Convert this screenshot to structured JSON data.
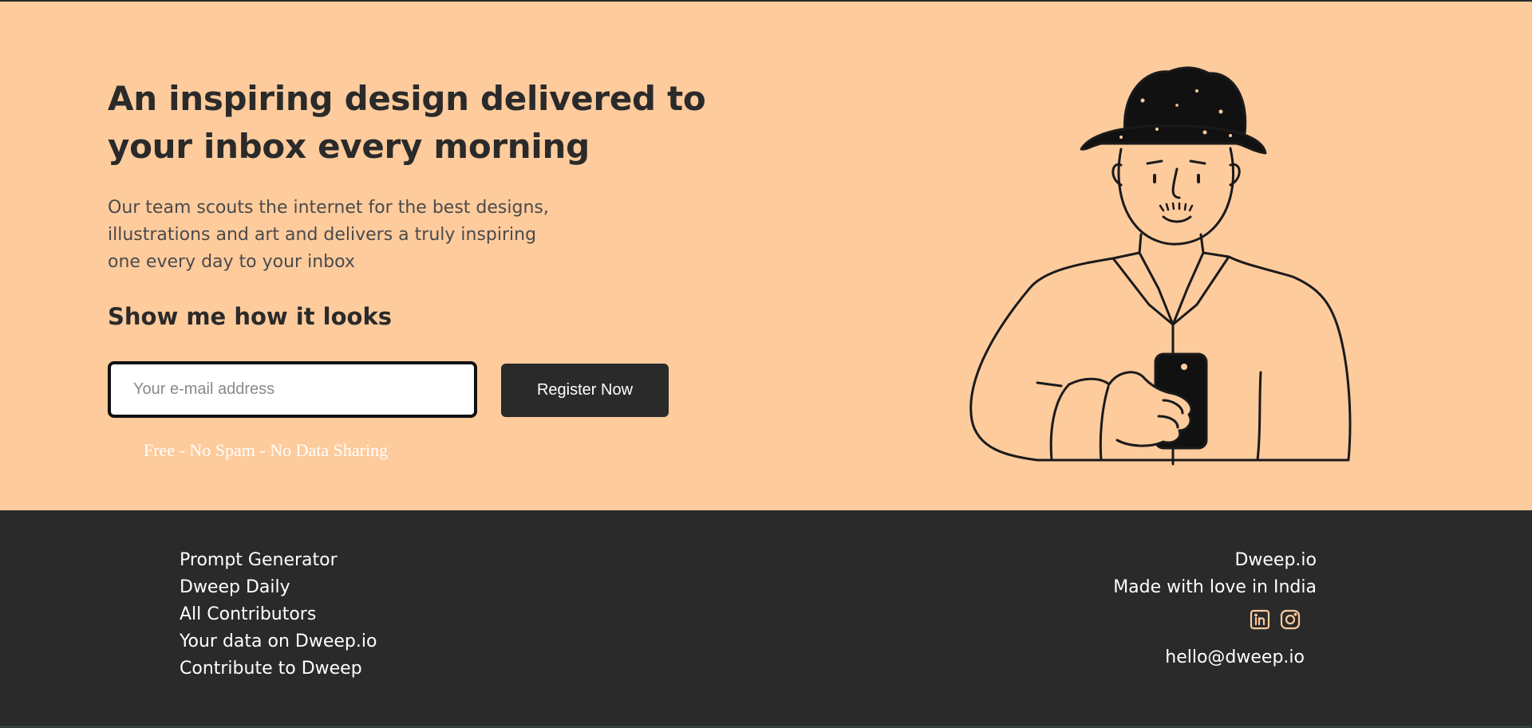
{
  "hero": {
    "title_line1": "An inspiring design delivered to",
    "title_line2": "your inbox every morning",
    "description_line1": "Our team scouts the internet for the best designs,",
    "description_line2": "illustrations and art and delivers a truly inspiring",
    "description_line3": "one every day to your inbox",
    "cta_heading": "Show me how it looks",
    "email_placeholder": "Your e-mail address",
    "register_label": "Register Now",
    "fine_print": "Free - No Spam - No Data Sharing",
    "illustration_icon": "man-with-hat-holding-phone-illustration"
  },
  "footer": {
    "links": [
      "Prompt Generator",
      "Dweep Daily",
      "All Contributors",
      "Your data on Dweep.io",
      "Contribute to Dweep"
    ],
    "brand": "Dweep.io",
    "tagline": "Made with love in India",
    "socials": [
      "linkedin-icon",
      "instagram-icon"
    ],
    "email": "hello@dweep.io"
  },
  "colors": {
    "hero_bg": "#fecb9d",
    "dark": "#2a2a2a",
    "icon_accent": "#fecb9d"
  }
}
